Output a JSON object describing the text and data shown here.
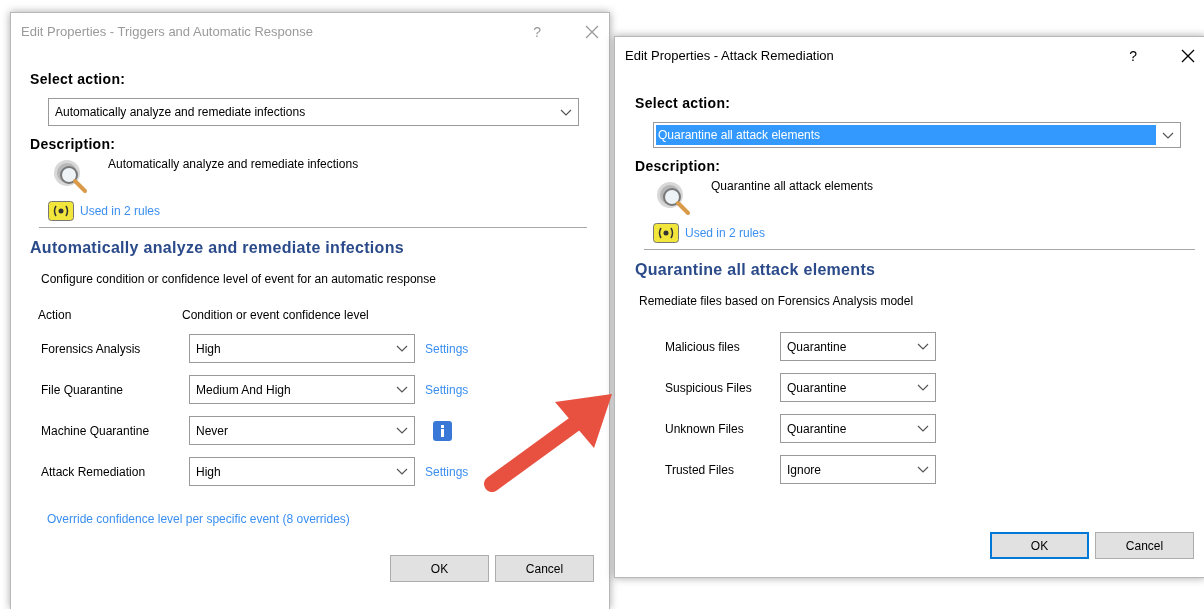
{
  "dialogs": [
    {
      "title": "Edit Properties - Triggers and Automatic Response",
      "active": false,
      "help": "?",
      "select_label": "Select action:",
      "action": {
        "value": "Automatically analyze and remediate infections",
        "highlighted": false
      },
      "description_label": "Description:",
      "description": "Automatically analyze and remediate infections",
      "used_in": "Used in 2 rules",
      "section_title": "Automatically analyze and remediate infections",
      "section_text": "Configure condition or confidence level of event for an automatic response",
      "headers": [
        "Action",
        "Condition or event confidence level"
      ],
      "rows": [
        {
          "label": "Forensics Analysis",
          "value": "High",
          "kind": "link",
          "link": "Settings"
        },
        {
          "label": "File Quarantine",
          "value": "Medium And High",
          "kind": "link",
          "link": "Settings"
        },
        {
          "label": "Machine Quarantine",
          "value": "Never",
          "kind": "info"
        },
        {
          "label": "Attack Remediation",
          "value": "High",
          "kind": "link",
          "link": "Settings"
        }
      ],
      "footer_link": "Override confidence level per specific event (8 overrides)",
      "buttons": [
        {
          "label": "OK",
          "default": false
        },
        {
          "label": "Cancel",
          "default": false
        }
      ]
    },
    {
      "title": "Edit Properties - Attack Remediation",
      "active": true,
      "help": "?",
      "select_label": "Select action:",
      "action": {
        "value": "Quarantine all attack elements",
        "highlighted": true
      },
      "description_label": "Description:",
      "description": "Quarantine all attack elements",
      "used_in": "Used in 2 rules",
      "section_title": "Quarantine all attack elements",
      "section_text": "Remediate files based on Forensics Analysis model",
      "rows": [
        {
          "label": "Malicious files",
          "value": "Quarantine",
          "kind": "plain"
        },
        {
          "label": "Suspicious Files",
          "value": "Quarantine",
          "kind": "plain"
        },
        {
          "label": "Unknown Files",
          "value": "Quarantine",
          "kind": "plain"
        },
        {
          "label": "Trusted Files",
          "value": "Ignore",
          "kind": "plain"
        }
      ],
      "buttons": [
        {
          "label": "OK",
          "default": true
        },
        {
          "label": "Cancel",
          "default": false
        }
      ]
    }
  ]
}
